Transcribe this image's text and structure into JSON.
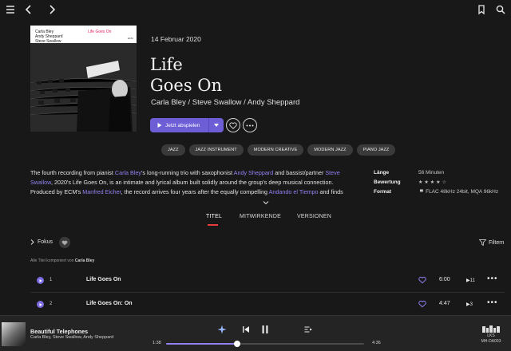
{
  "header": {
    "date": "14 Februar 2020",
    "title_line1": "Life",
    "title_line2": "Goes On",
    "artists": "Carla Bley / Steve Swallow / Andy Sheppard",
    "play_label": "Jetzt abspielen"
  },
  "cover": {
    "artist1": "Carla Bley",
    "artist2": "Andy Sheppard",
    "artist3": "Steve Swallow",
    "title": "Life Goes On",
    "label": "ECM"
  },
  "tags": [
    "JAZZ",
    "JAZZ INSTRUMENT",
    "MODERN CREATIVE",
    "MODERN JAZZ",
    "PIANO JAZZ"
  ],
  "description": {
    "p1": "The fourth recording from pianist ",
    "l1": "Carla Bley",
    "p2": "'s long-running trio with saxophonist ",
    "l2": "Andy Sheppard",
    "p3": " and bassist/partner ",
    "l3": "Steve Swallow",
    "p4": ", 2020's Life Goes On, is an intimate and lyrical album built solidly around the group's deep musical connection. Produced by ECM's ",
    "l4": "Manfred Eicher",
    "p5": ", the record arrives four years after the equally compelling ",
    "l5": "Andando el Tiempo",
    "p6": " and finds"
  },
  "meta": {
    "length_label": "Länge",
    "length_value": "56 Minuten",
    "rating_label": "Bewertung",
    "rating_value": 4,
    "rating_max": 5,
    "format_label": "Format",
    "format_value": "FLAC 48kHz 24bit, MQA 96kHz"
  },
  "tabs": [
    "TITEL",
    "MITWIRKENDE",
    "VERSIONEN"
  ],
  "filter_bar": {
    "focus_label": "Fokus",
    "filter_label": "Filtern"
  },
  "composer": {
    "prefix": "Alle Titel komponiert von ",
    "name": "Carla Bley"
  },
  "tracks": [
    {
      "num": "1",
      "title": "Life Goes On",
      "duration": "6:00",
      "quality": "11"
    },
    {
      "num": "2",
      "title": "Life Goes On: On",
      "duration": "4:47",
      "quality": "3"
    }
  ],
  "player": {
    "title": "Beautiful Telephones",
    "artists": "Carla Bley, Steve Swallow, Andy Sheppard",
    "elapsed": "1:38",
    "total": "4:36",
    "progress": 0.36,
    "device_line1": "LKS",
    "device_line2": "MH-DA003"
  },
  "colors": {
    "accent": "#6e5ed6",
    "link": "#8f82f0",
    "tab_underline": "#e53d3d"
  }
}
